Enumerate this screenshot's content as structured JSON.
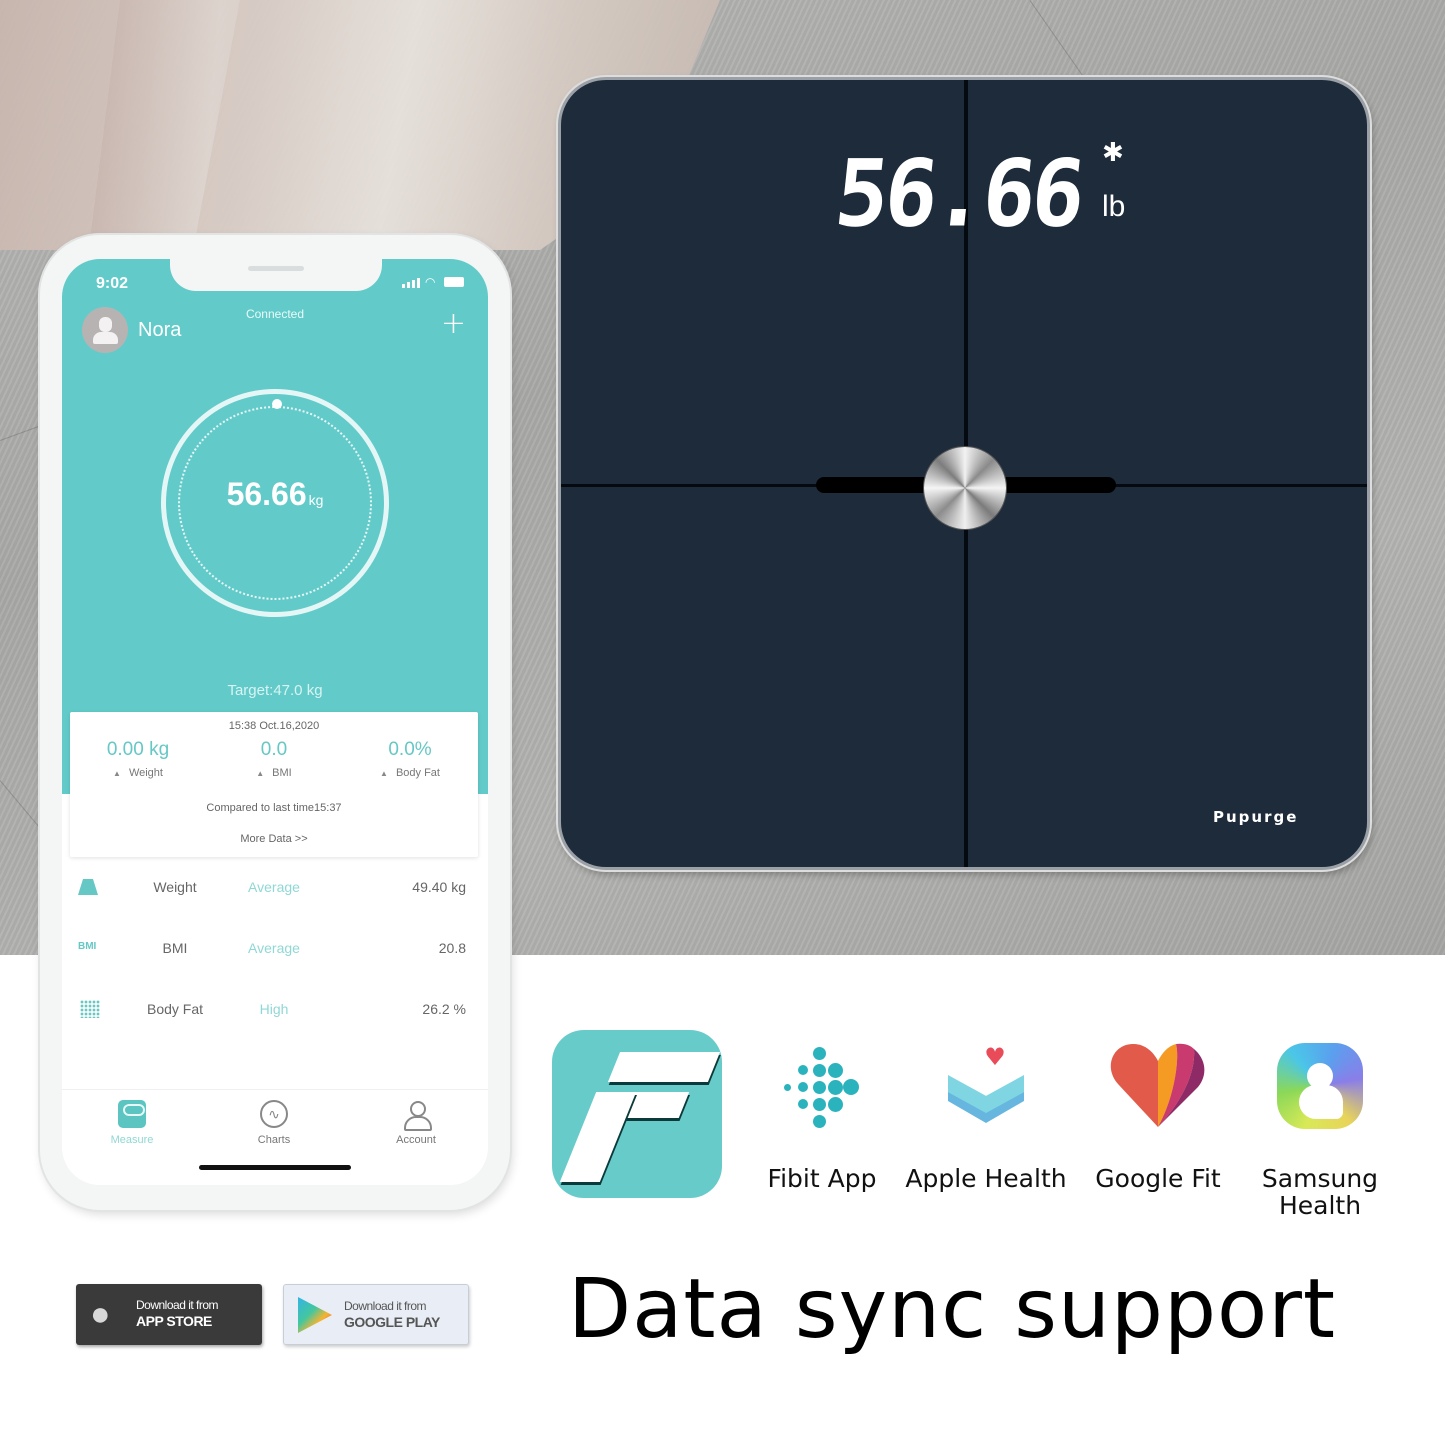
{
  "phone": {
    "status_bar": {
      "time": "9:02"
    },
    "header": {
      "user_name": "Nora",
      "connection_status": "Connected",
      "add_icon": "plus-icon"
    },
    "gauge": {
      "value": "56.66",
      "unit": "kg"
    },
    "target": "Target:47.0 kg",
    "summary_card": {
      "timestamp": "15:38 Oct.16,2020",
      "metrics": [
        {
          "value": "0.00 kg",
          "label": "Weight",
          "trend": "up"
        },
        {
          "value": "0.0",
          "label": "BMI",
          "trend": "up"
        },
        {
          "value": "0.0%",
          "label": "Body Fat",
          "trend": "up"
        }
      ],
      "compared_text": "Compared to last time15:37",
      "more_link": "More Data >>"
    },
    "metrics_list": [
      {
        "icon": "weight-icon",
        "name": "Weight",
        "status": "Average",
        "value": "49.40 kg"
      },
      {
        "icon": "bmi-icon",
        "icon_text": "BMI",
        "name": "BMI",
        "status": "Average",
        "value": "20.8"
      },
      {
        "icon": "body-fat-icon",
        "name": "Body Fat",
        "status": "High",
        "value": "26.2 %"
      }
    ],
    "tabbar": [
      {
        "label": "Measure",
        "icon": "scale-icon",
        "active": true
      },
      {
        "label": "Charts",
        "icon": "chart-icon",
        "active": false
      },
      {
        "label": "Account",
        "icon": "person-icon",
        "active": false
      }
    ]
  },
  "scale": {
    "display_value": "56.66",
    "unit": "lb",
    "bluetooth_icon": "bluetooth-icon",
    "brand": "Pupurge"
  },
  "sync_apps": [
    {
      "name": "Fitdays",
      "label": ""
    },
    {
      "name": "fitbit",
      "label": "Fibit App"
    },
    {
      "name": "apple-health",
      "label": "Apple Health"
    },
    {
      "name": "google-fit",
      "label": "Google Fit"
    },
    {
      "name": "samsung-health",
      "label_line1": "Samsung",
      "label_line2": "Health"
    }
  ],
  "store_badges": {
    "app_store": {
      "line1": "Download it from",
      "line2": "APP STORE"
    },
    "google_play": {
      "line1": "Download it from",
      "line2": "GOOGLE PLAY"
    }
  },
  "headline": "Data sync support",
  "colors": {
    "accent_teal": "#62cbc9",
    "scale_body": "#1d2b3b",
    "status_text_teal": "#8fd8d5"
  }
}
